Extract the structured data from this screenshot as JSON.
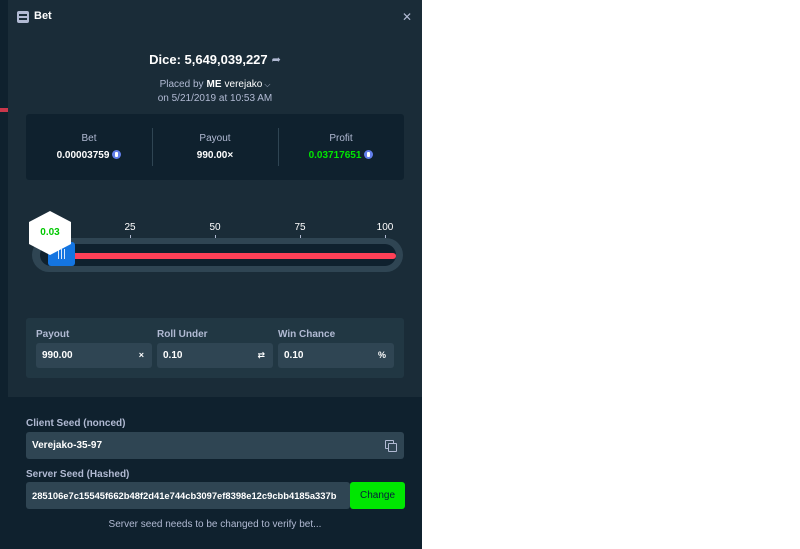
{
  "modal": {
    "title": "Bet",
    "close_glyph": "✕"
  },
  "bet": {
    "game_title": "Dice: 5,649,039,227",
    "placed_by_label": "Placed by",
    "badge": "ME",
    "username": "verejako",
    "date_line": "on 5/21/2019 at 10:53 AM"
  },
  "stats": {
    "bet_label": "Bet",
    "bet_value": "0.00003759",
    "payout_label": "Payout",
    "payout_value": "990.00×",
    "profit_label": "Profit",
    "profit_value": "0.03717651",
    "currency_icon": "ethereum-coin-icon"
  },
  "slider": {
    "ticks": [
      "25",
      "50",
      "75",
      "100"
    ],
    "result_value": 0.03,
    "result_label": "0.03",
    "roll_under": 0.1,
    "min": 0,
    "max": 100
  },
  "inputs": {
    "payout_label": "Payout",
    "payout_value": "990.00",
    "payout_suffix": "×",
    "roll_under_label": "Roll Under",
    "roll_under_value": "0.10",
    "roll_under_suffix": "⇄",
    "win_chance_label": "Win Chance",
    "win_chance_value": "0.10",
    "win_chance_suffix": "%"
  },
  "seeds": {
    "client_label": "Client Seed (nonced)",
    "client_value": "Verejako-35-97",
    "server_label": "Server Seed (Hashed)",
    "server_value": "285106e7c15545f662b48f2d41e744cb3097ef8398e12c9cbb4185a337b",
    "change_label": "Change",
    "note": "Server seed needs to be changed to verify bet..."
  },
  "colors": {
    "panel": "#1a2c38",
    "dark": "#0f212e",
    "input": "#2f4553",
    "green": "#00e701",
    "red": "#ff4057",
    "blue": "#1475e1",
    "muted": "#b1bad3"
  }
}
